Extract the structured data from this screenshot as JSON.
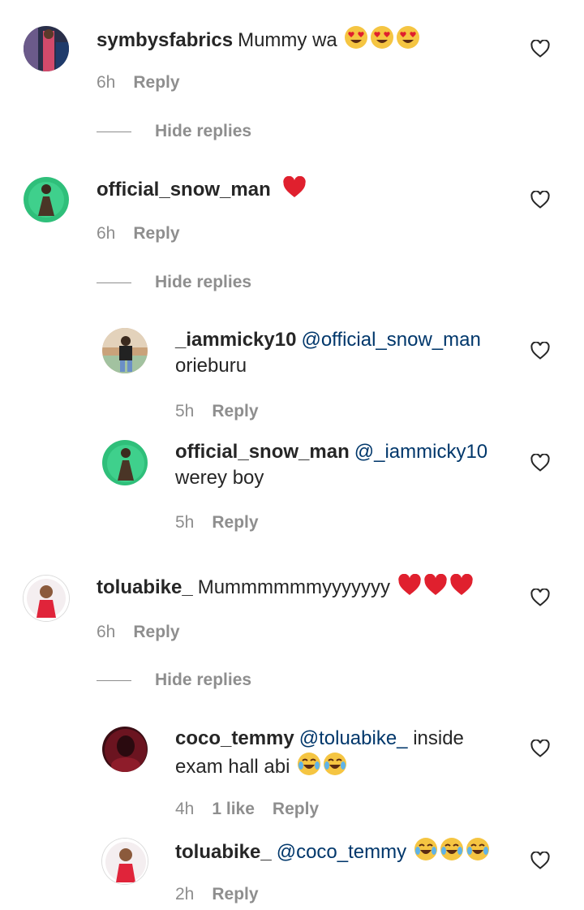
{
  "comments": [
    {
      "user": "symbysfabrics",
      "text": "Mummy wa",
      "emojis": [
        "heart-eyes",
        "heart-eyes",
        "heart-eyes"
      ],
      "time": "6h",
      "reply": "Reply",
      "hide_replies": "Hide replies"
    },
    {
      "user": "official_snow_man",
      "text": "",
      "emojis": [
        "red-heart"
      ],
      "time": "6h",
      "reply": "Reply",
      "hide_replies": "Hide replies",
      "replies": [
        {
          "user": "_iammicky10",
          "mention": "@official_snow_man",
          "text": "orieburu",
          "time": "5h",
          "reply": "Reply"
        },
        {
          "user": "official_snow_man",
          "mention": "@_iammicky10",
          "text": "werey boy",
          "time": "5h",
          "reply": "Reply"
        }
      ]
    },
    {
      "user": "toluabike_",
      "text": "Mummmmmmyyyyyyy",
      "emojis": [
        "red-heart",
        "red-heart",
        "red-heart"
      ],
      "time": "6h",
      "reply": "Reply",
      "hide_replies": "Hide replies",
      "replies": [
        {
          "user": "coco_temmy",
          "mention": "@toluabike_",
          "text": "inside",
          "text2": "exam hall abi",
          "emojis": [
            "tears-of-joy",
            "tears-of-joy"
          ],
          "time": "4h",
          "likes": "1 like",
          "reply": "Reply"
        },
        {
          "user": "toluabike_",
          "mention": "@coco_temmy",
          "text": "",
          "emojis": [
            "tears-of-joy",
            "tears-of-joy",
            "tears-of-joy"
          ],
          "time": "2h",
          "reply": "Reply"
        }
      ]
    }
  ],
  "colors": {
    "text": "#262626",
    "meta": "#8e8e8e",
    "mention": "#00376b",
    "heart": "#e0202e"
  },
  "icons": {
    "like": "heart-outline-icon"
  }
}
